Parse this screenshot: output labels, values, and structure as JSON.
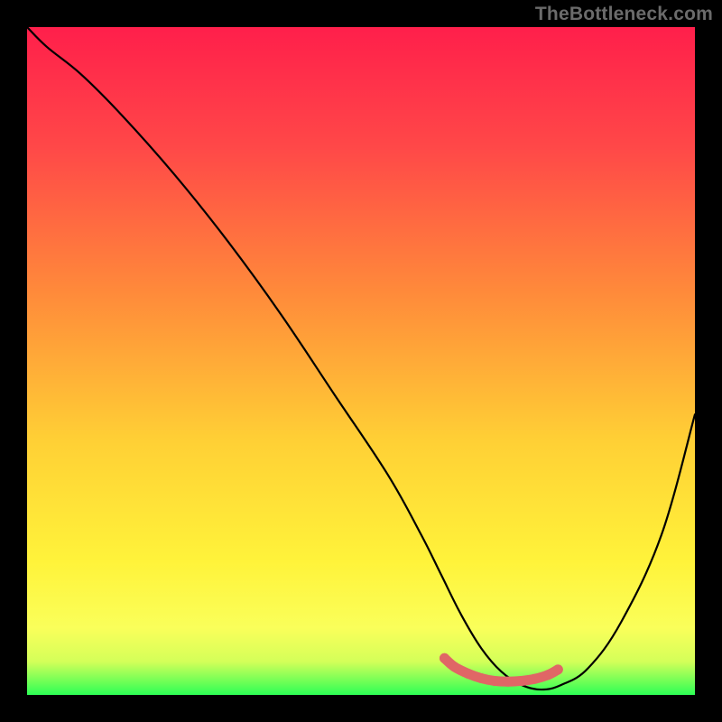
{
  "watermark": "TheBottleneck.com",
  "chart_data": {
    "type": "line",
    "title": "",
    "xlabel": "",
    "ylabel": "",
    "xlim": [
      0,
      100
    ],
    "ylim": [
      0,
      100
    ],
    "gradient_stops": [
      {
        "offset": 0,
        "color": "#ff1f4b"
      },
      {
        "offset": 18,
        "color": "#ff4848"
      },
      {
        "offset": 40,
        "color": "#ff8b3a"
      },
      {
        "offset": 62,
        "color": "#ffd035"
      },
      {
        "offset": 80,
        "color": "#fff33a"
      },
      {
        "offset": 90,
        "color": "#faff5a"
      },
      {
        "offset": 95,
        "color": "#d4ff59"
      },
      {
        "offset": 100,
        "color": "#2dff55"
      }
    ],
    "series": [
      {
        "name": "bottleneck-curve",
        "color": "#000000",
        "x": [
          0,
          3,
          8,
          14,
          22,
          30,
          38,
          46,
          54,
          59,
          62,
          65,
          68,
          71,
          74,
          77,
          80,
          84,
          89,
          95,
          100
        ],
        "y": [
          100,
          97,
          93,
          87,
          78,
          68,
          57,
          45,
          33,
          24,
          18,
          12,
          7,
          3.5,
          1.5,
          0.8,
          1.5,
          4,
          11,
          24,
          42
        ]
      },
      {
        "name": "optimal-marker",
        "color": "#e06666",
        "type": "segment",
        "x": [
          62.5,
          64,
          66,
          68,
          70,
          72,
          74,
          76,
          78,
          79.5
        ],
        "y": [
          5.5,
          4.2,
          3.2,
          2.5,
          2.1,
          2.0,
          2.1,
          2.4,
          3.0,
          3.8
        ]
      }
    ]
  }
}
